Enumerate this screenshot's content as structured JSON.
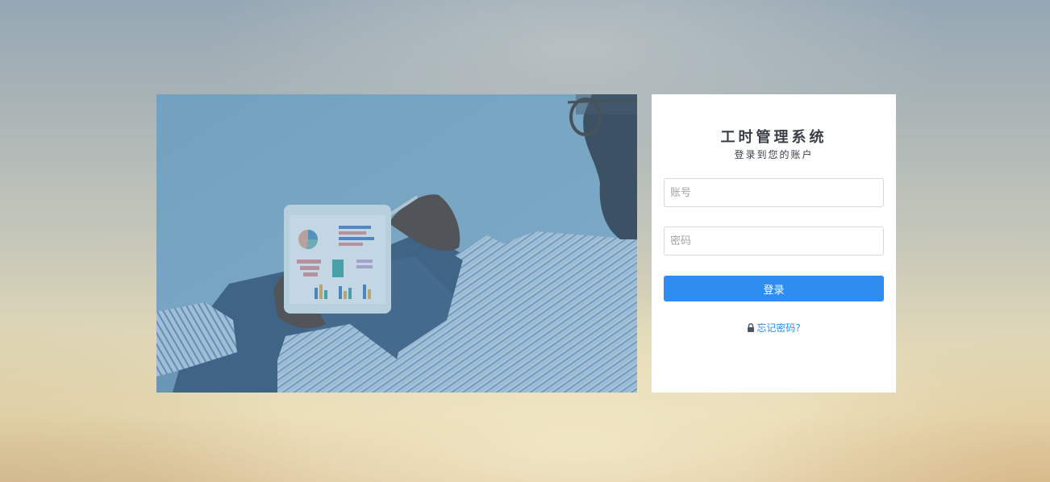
{
  "login": {
    "title": "工时管理系统",
    "subtitle": "登录到您的账户",
    "username_placeholder": "账号",
    "username_value": "",
    "password_placeholder": "密码",
    "password_value": "",
    "submit_label": "登录",
    "forgot_label": "忘记密码?"
  },
  "icons": {
    "forgot": "lock-icon"
  },
  "colors": {
    "accent": "#2f8cf0",
    "title_text": "#3a3f47",
    "photo_tint": "#7ba5bf"
  }
}
